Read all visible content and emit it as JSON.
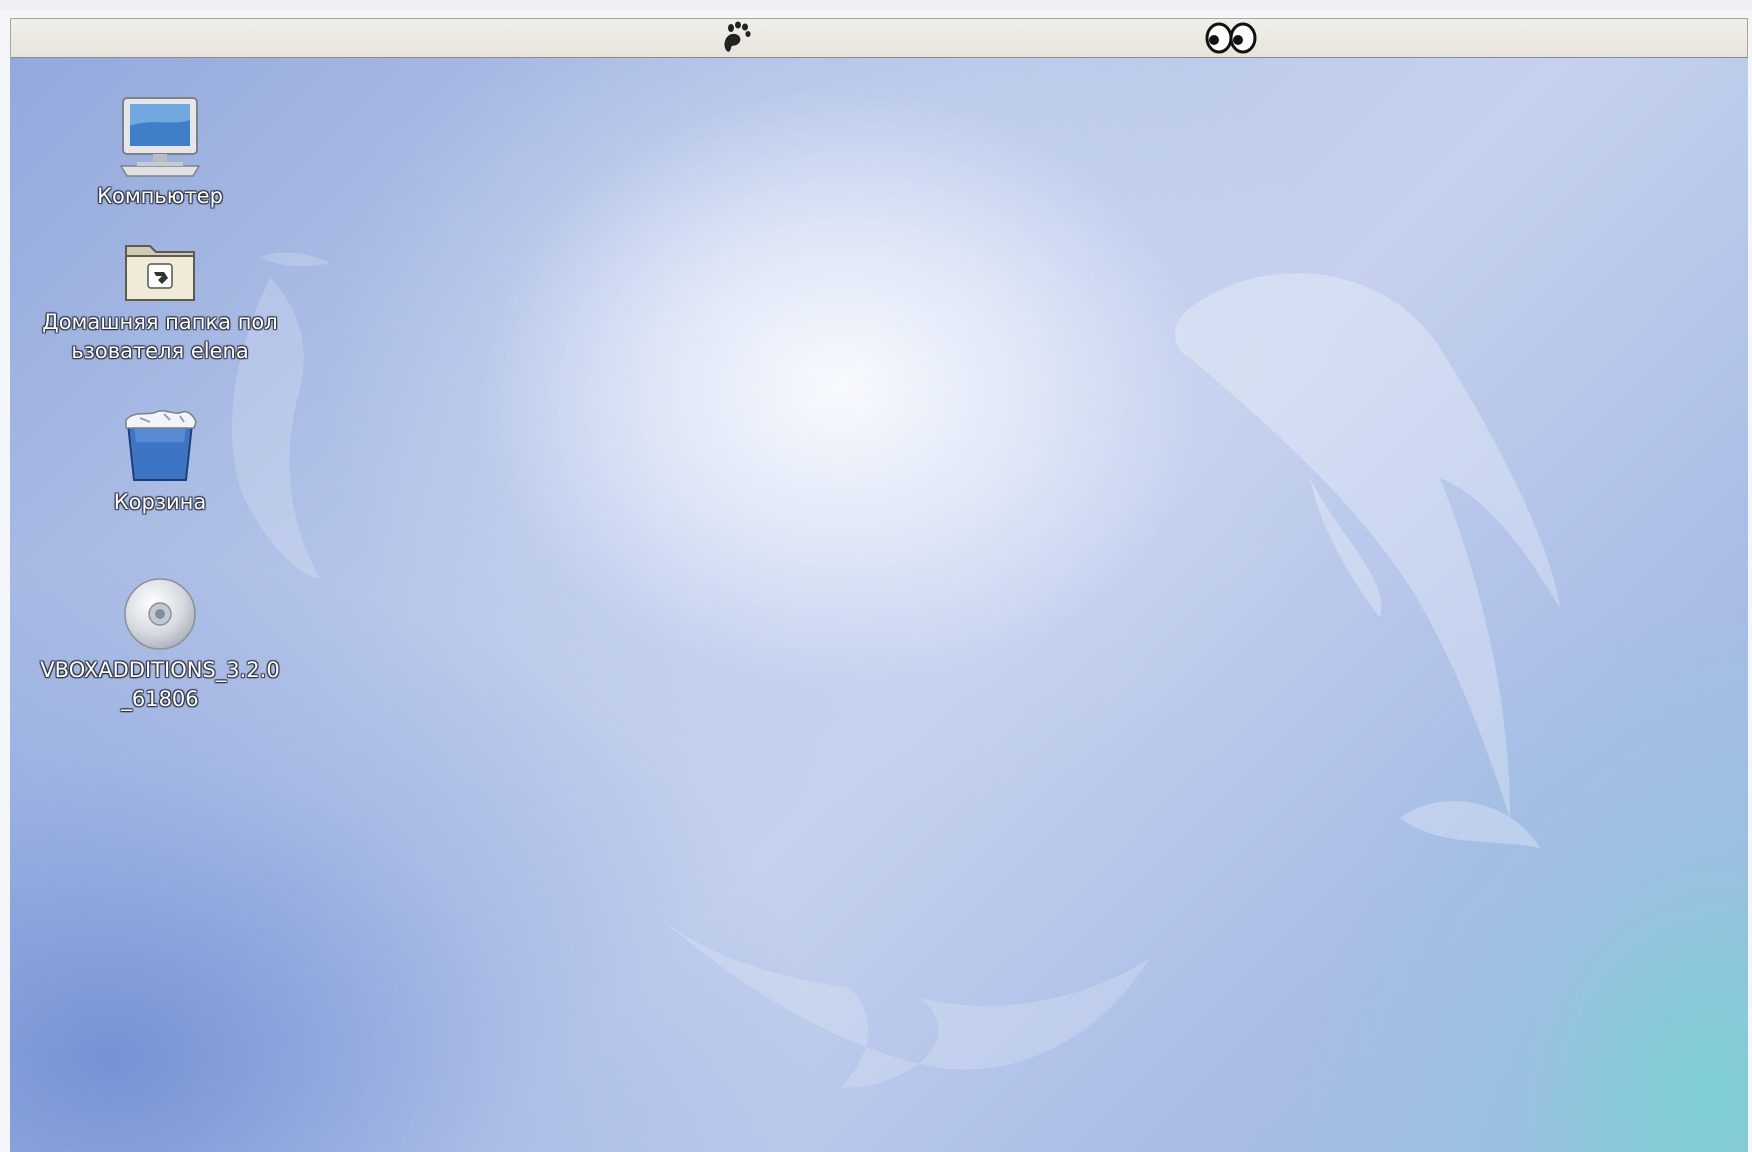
{
  "panel": {
    "left_icon": "gnome-foot-icon",
    "right_icon": "eyes-icon"
  },
  "desktop": {
    "wallpaper": "blue-dolphins",
    "icons": [
      {
        "label": "Компьютер",
        "icon": "computer-icon"
      },
      {
        "label": "Домашняя папка пользователя elena",
        "icon": "home-folder-icon"
      },
      {
        "label": "Корзина",
        "icon": "trash-icon"
      },
      {
        "label": "VBOXADDITIONS_3.2.0_61806",
        "icon": "cdrom-icon"
      }
    ]
  },
  "colors": {
    "panel_bg": "#ece9e2",
    "desktop_base": "#a9bce6",
    "label_text": "#ffffff"
  }
}
